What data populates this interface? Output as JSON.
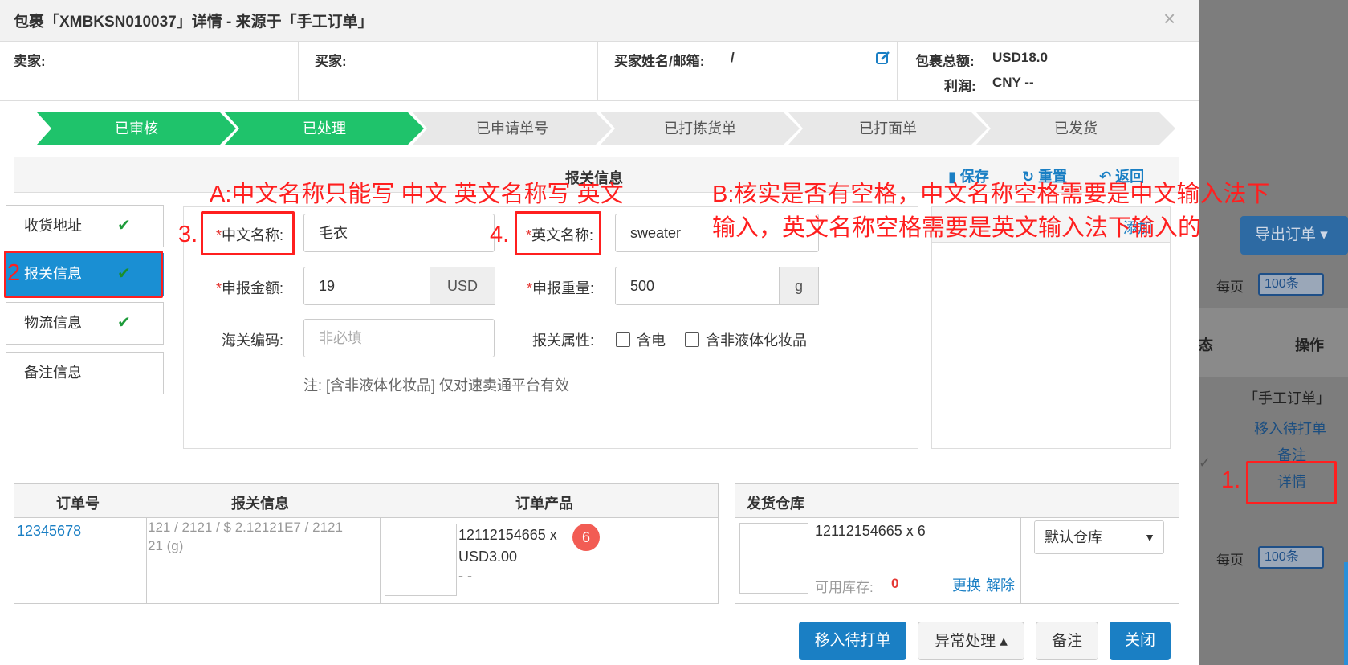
{
  "modal": {
    "title": "包裹「XMBKSN010037」详情 - 来源于「手工订单」",
    "close": "×"
  },
  "info": {
    "seller_label": "卖家:",
    "buyer_label": "买家:",
    "buyer_name_label": "买家姓名/邮箱:",
    "buyer_name_value": "/",
    "total_label": "包裹总额:",
    "total_value": "USD18.0",
    "profit_label": "利润:",
    "profit_value": "CNY --"
  },
  "steps": [
    {
      "label": "已审核",
      "state": "done"
    },
    {
      "label": "已处理",
      "state": "done"
    },
    {
      "label": "已申请单号",
      "state": "todo"
    },
    {
      "label": "已打拣货单",
      "state": "todo"
    },
    {
      "label": "已打面单",
      "state": "todo"
    },
    {
      "label": "已发货",
      "state": "todo"
    }
  ],
  "panel": {
    "title": "报关信息",
    "save": "保存",
    "reset": "重置",
    "back": "返回"
  },
  "sidenav": [
    {
      "label": "收货地址",
      "checked": true
    },
    {
      "label": "报关信息",
      "checked": true,
      "active": true
    },
    {
      "label": "物流信息",
      "checked": true
    },
    {
      "label": "备注信息",
      "checked": false
    }
  ],
  "form": {
    "cn_name_label": "中文名称:",
    "cn_name_value": "毛衣",
    "en_name_label": "英文名称:",
    "en_name_value": "sweater",
    "amount_label": "申报金额:",
    "amount_value": "19",
    "amount_unit": "USD",
    "weight_label": "申报重量:",
    "weight_value": "500",
    "weight_unit": "g",
    "hs_label": "海关编码:",
    "hs_placeholder": "非必填",
    "attr_label": "报关属性:",
    "attr_opt1": "含电",
    "attr_opt2": "含非液体化妆品",
    "note": "注: [含非液体化妆品] 仅对速卖通平台有效"
  },
  "rightbox": {
    "add_link": "添加"
  },
  "order_table": {
    "headers": [
      "订单号",
      "报关信息",
      "订单产品"
    ],
    "order_no": "12345678",
    "customs_info_line1": "121 / 2121 / $ 2.12121E7 / 2121",
    "customs_info_line2": "21 (g)",
    "product_sku": "12112154665 x",
    "product_qty": "6",
    "product_price": "USD3.00",
    "product_extra": "- -"
  },
  "warehouse_table": {
    "header": "发货仓库",
    "sku_line": "12112154665 x 6",
    "stock_label": "可用库存:",
    "stock_value": "0",
    "replace": "更换",
    "unbind": "解除",
    "warehouse_select": "默认仓库"
  },
  "footer": {
    "move_pending": "移入待打单",
    "exception": "异常处理 ▴",
    "remark": "备注",
    "close": "关闭"
  },
  "background": {
    "export_btn": "导出订单 ▾",
    "per_page": "每页",
    "per_page_value": "100条",
    "col_status": "态",
    "col_op": "操作",
    "source": "「手工订单」",
    "link_move": "移入待打单",
    "link_remark": "备注",
    "link_detail": "详情"
  },
  "annotations": {
    "a": "A:中文名称只能写 中文 英文名称写 英文",
    "b_line1": "B:核实是否有空格，中文名称空格需要是中文输入法下",
    "b_line2": "输入，英文名称空格需要是英文输入法下输入的",
    "n1": "1.",
    "n2": "2",
    "n3": "3.",
    "n4": "4."
  },
  "colors": {
    "step_done": "#1fc36b",
    "step_todo": "#e8e8e8",
    "primary": "#1a7fc4",
    "annotation": "#ff1f1f"
  }
}
